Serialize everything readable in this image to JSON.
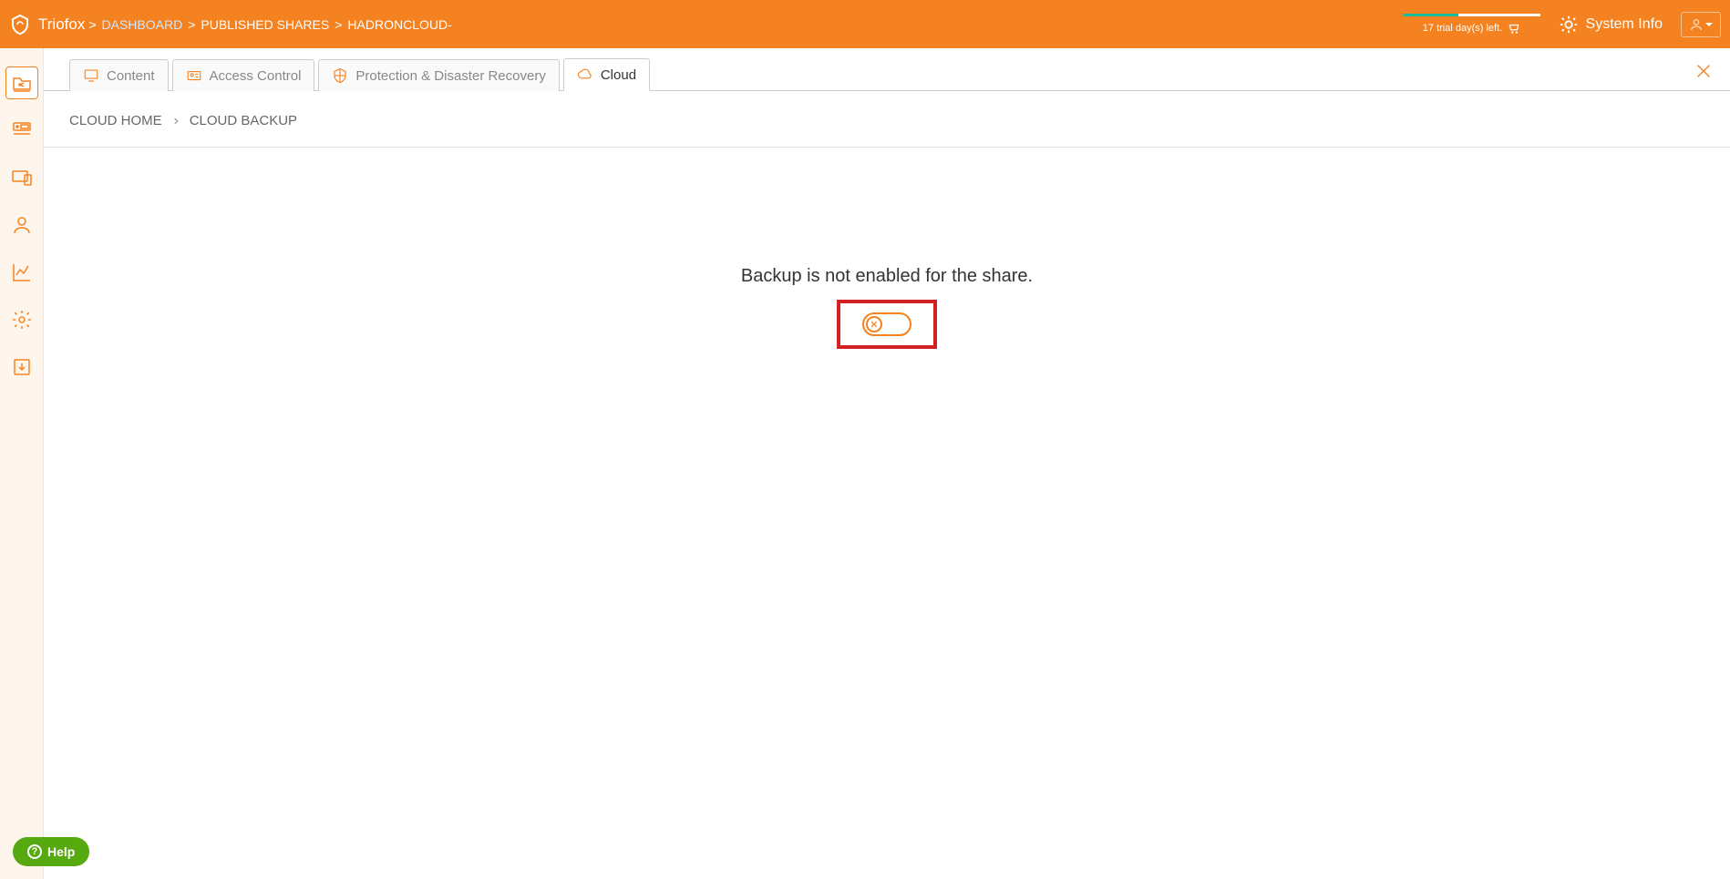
{
  "header": {
    "brand": "Triofox",
    "breadcrumb": [
      {
        "label": "DASHBOARD",
        "active": true
      },
      {
        "label": "PUBLISHED SHARES",
        "active": false
      },
      {
        "label": "HADRONCLOUD-",
        "active": false
      }
    ],
    "trial_text": "17 trial day(s) left.",
    "system_info": "System Info"
  },
  "tabs": [
    {
      "label": "Content",
      "icon": "monitor-icon"
    },
    {
      "label": "Access Control",
      "icon": "id-card-icon"
    },
    {
      "label": "Protection & Disaster Recovery",
      "icon": "shield-icon"
    },
    {
      "label": "Cloud",
      "icon": "cloud-icon",
      "active": true
    }
  ],
  "sub_breadcrumb": {
    "items": [
      "CLOUD HOME",
      "CLOUD BACKUP"
    ]
  },
  "content": {
    "message": "Backup is not enabled for the share."
  },
  "help": {
    "label": "Help"
  }
}
